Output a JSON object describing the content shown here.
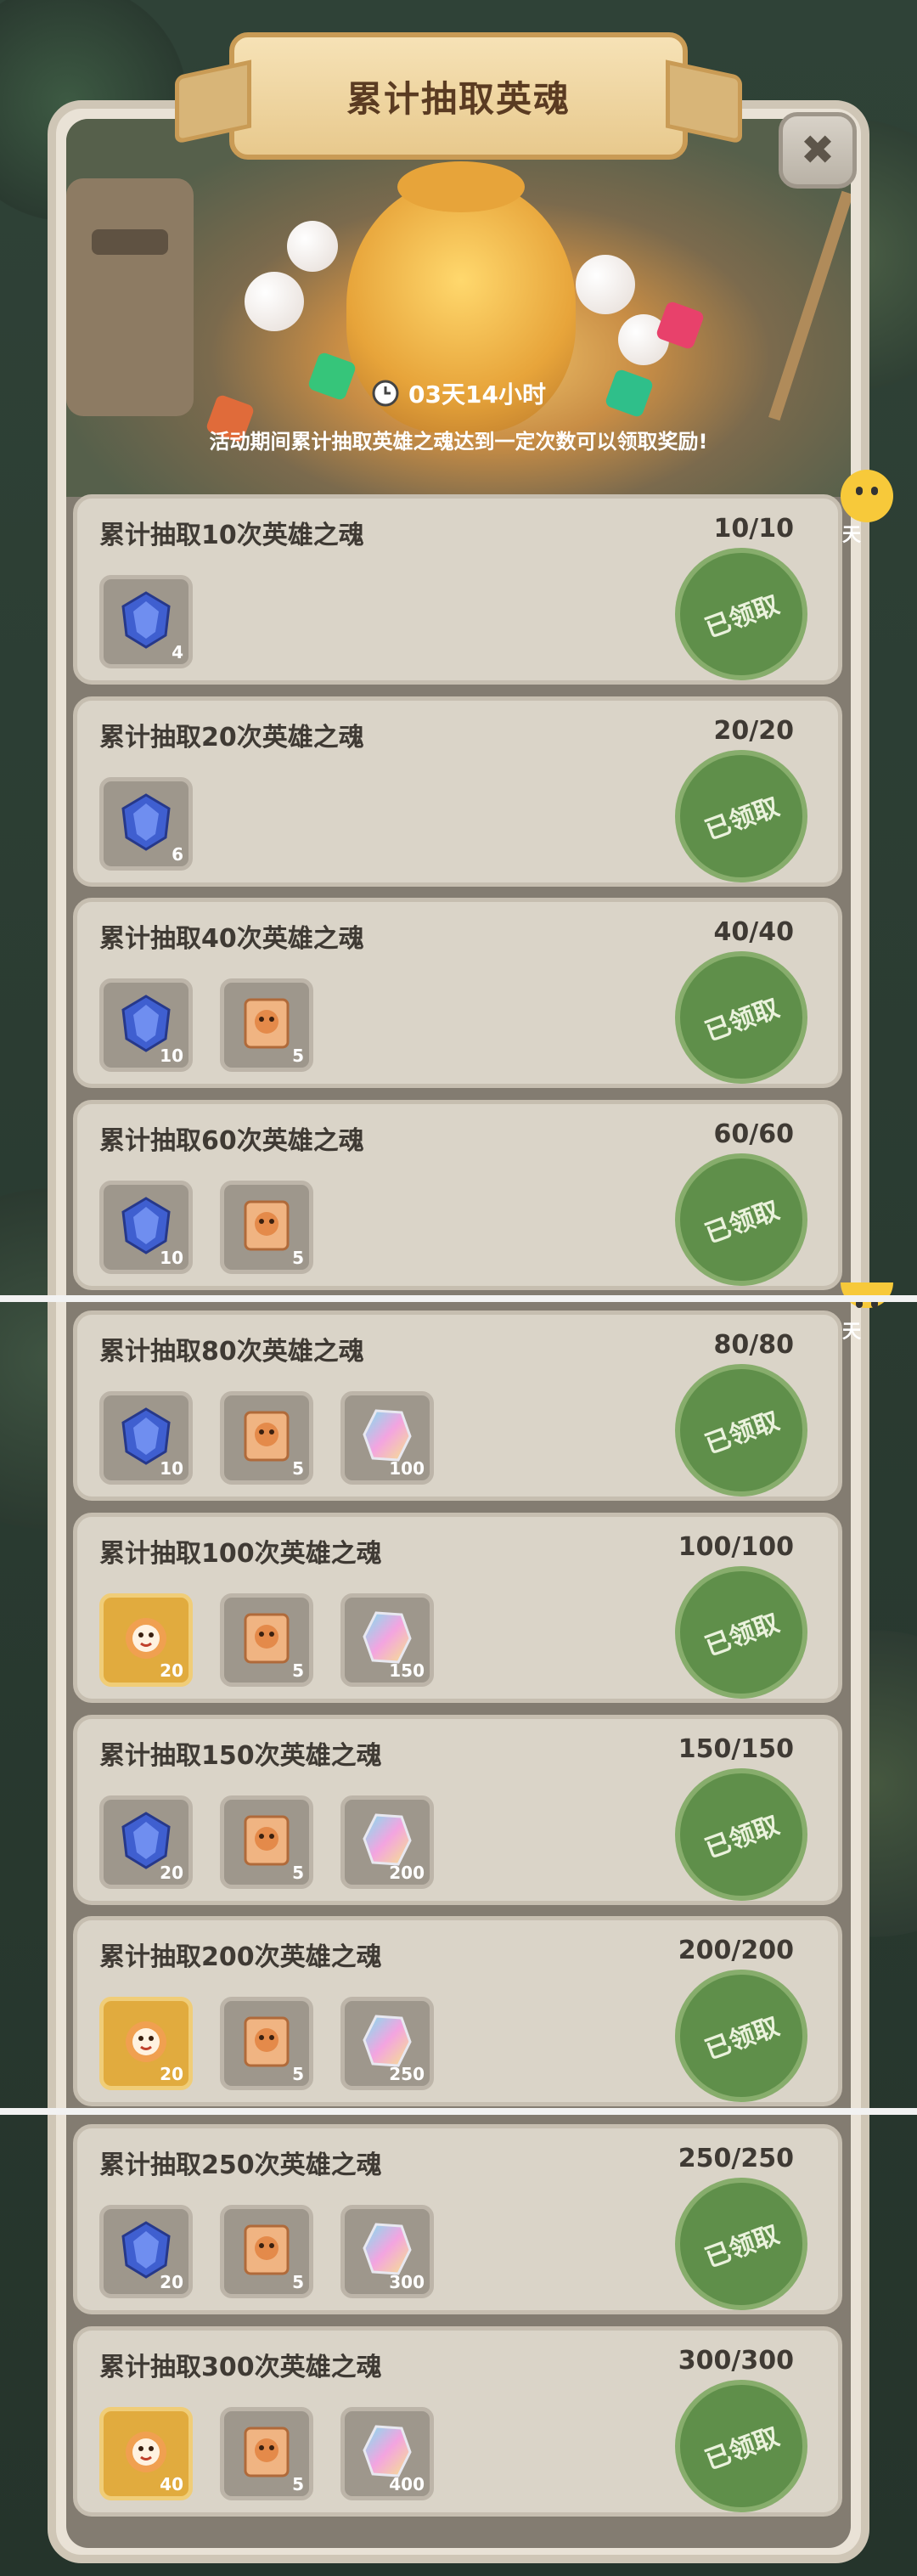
{
  "header": {
    "title": "累计抽取英魂",
    "timer": "03天14小时",
    "description": "活动期间累计抽取英雄之魂达到一定次数可以领取奖励!",
    "close_glyph": "✖"
  },
  "chat": {
    "label": "聊天"
  },
  "milestones": [
    {
      "title": "累计抽取10次英雄之魂",
      "progress": "10/10",
      "status": "已领取",
      "rewards": [
        {
          "icon": "blue-soul-crystal-icon",
          "qty": "4"
        }
      ]
    },
    {
      "title": "累计抽取20次英雄之魂",
      "progress": "20/20",
      "status": "已领取",
      "rewards": [
        {
          "icon": "blue-soul-crystal-icon",
          "qty": "6"
        }
      ]
    },
    {
      "title": "累计抽取40次英雄之魂",
      "progress": "40/40",
      "status": "已领取",
      "rewards": [
        {
          "icon": "blue-soul-crystal-icon",
          "qty": "10"
        },
        {
          "icon": "tiger-scroll-icon",
          "qty": "5"
        }
      ]
    },
    {
      "title": "累计抽取60次英雄之魂",
      "progress": "60/60",
      "status": "已领取",
      "rewards": [
        {
          "icon": "blue-soul-crystal-icon",
          "qty": "10"
        },
        {
          "icon": "tiger-scroll-icon",
          "qty": "5"
        }
      ]
    },
    {
      "title": "累计抽取80次英雄之魂",
      "progress": "80/80",
      "status": "已领取",
      "rewards": [
        {
          "icon": "blue-soul-crystal-icon",
          "qty": "10"
        },
        {
          "icon": "tiger-scroll-icon",
          "qty": "5"
        },
        {
          "icon": "rainbow-crystal-icon",
          "qty": "100"
        }
      ]
    },
    {
      "title": "累计抽取100次英雄之魂",
      "progress": "100/100",
      "status": "已领取",
      "rewards": [
        {
          "icon": "tiger-hero-card-icon",
          "qty": "20"
        },
        {
          "icon": "tiger-scroll-icon",
          "qty": "5"
        },
        {
          "icon": "rainbow-crystal-icon",
          "qty": "150"
        }
      ]
    },
    {
      "title": "累计抽取150次英雄之魂",
      "progress": "150/150",
      "status": "已领取",
      "rewards": [
        {
          "icon": "blue-soul-crystal-icon",
          "qty": "20"
        },
        {
          "icon": "tiger-scroll-icon",
          "qty": "5"
        },
        {
          "icon": "rainbow-crystal-icon",
          "qty": "200"
        }
      ]
    },
    {
      "title": "累计抽取200次英雄之魂",
      "progress": "200/200",
      "status": "已领取",
      "rewards": [
        {
          "icon": "tiger-hero-card-icon",
          "qty": "20"
        },
        {
          "icon": "tiger-scroll-icon",
          "qty": "5"
        },
        {
          "icon": "rainbow-crystal-icon",
          "qty": "250"
        }
      ]
    },
    {
      "title": "累计抽取250次英雄之魂",
      "progress": "250/250",
      "status": "已领取",
      "rewards": [
        {
          "icon": "blue-soul-crystal-icon",
          "qty": "20"
        },
        {
          "icon": "tiger-scroll-icon",
          "qty": "5"
        },
        {
          "icon": "rainbow-crystal-icon",
          "qty": "300"
        }
      ]
    },
    {
      "title": "累计抽取300次英雄之魂",
      "progress": "300/300",
      "status": "已领取",
      "rewards": [
        {
          "icon": "tiger-hero-card-icon",
          "qty": "40"
        },
        {
          "icon": "tiger-scroll-icon",
          "qty": "5"
        },
        {
          "icon": "rainbow-crystal-icon",
          "qty": "400"
        }
      ]
    }
  ],
  "colors": {
    "claimed_stamp": "#5f8f4a",
    "card_bg": "#dad4c8",
    "title_plaque": "#f6e2b6"
  }
}
